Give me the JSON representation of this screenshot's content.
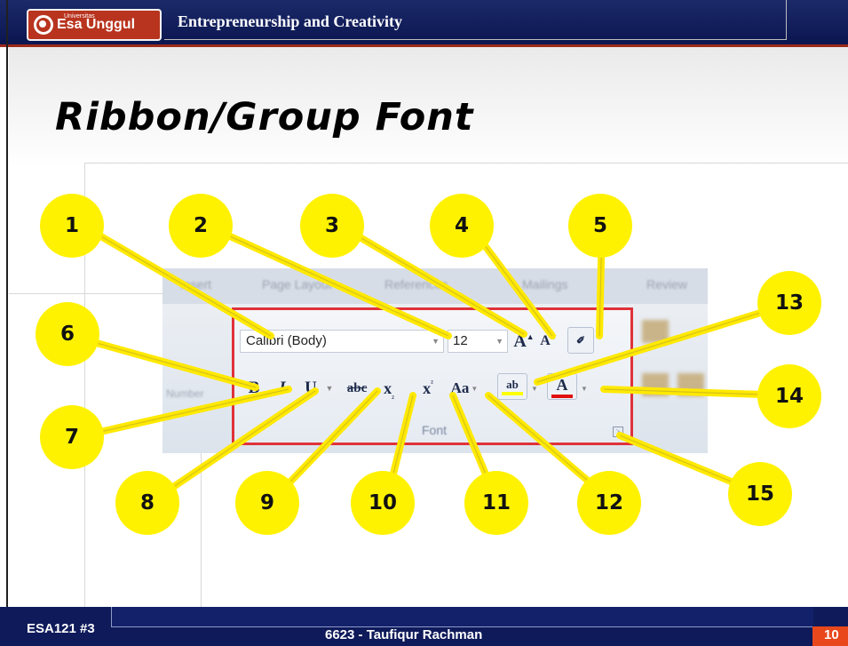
{
  "header": {
    "logo_small": "Universitas",
    "logo_text": "Esa Unggul",
    "title": "Entrepreneurship and Creativity"
  },
  "slide": {
    "title": "Ribbon/Group Font"
  },
  "ribbon": {
    "tabs": [
      "Insert",
      "Page Layout",
      "References",
      "Mailings",
      "Review"
    ],
    "font_name": "Calibri (Body)",
    "font_size": "12",
    "grow_font": "A",
    "shrink_font": "A",
    "bold": "B",
    "italic": "I",
    "underline": "U",
    "strike": "abc",
    "subscript": "x",
    "superscript": "x",
    "change_case": "Aa",
    "highlight": "ab",
    "font_color": "A",
    "group_label": "Font",
    "side_label": "Number"
  },
  "callouts": [
    "1",
    "2",
    "3",
    "4",
    "5",
    "6",
    "7",
    "8",
    "9",
    "10",
    "11",
    "12",
    "13",
    "14",
    "15"
  ],
  "footer": {
    "left": "ESA121 #3",
    "center": "6623 - Taufiqur Rachman",
    "page": "10"
  },
  "colors": {
    "callout": "#fff200",
    "group_border": "#e0323a",
    "header": "#0b1650",
    "accent": "#e8481c"
  }
}
